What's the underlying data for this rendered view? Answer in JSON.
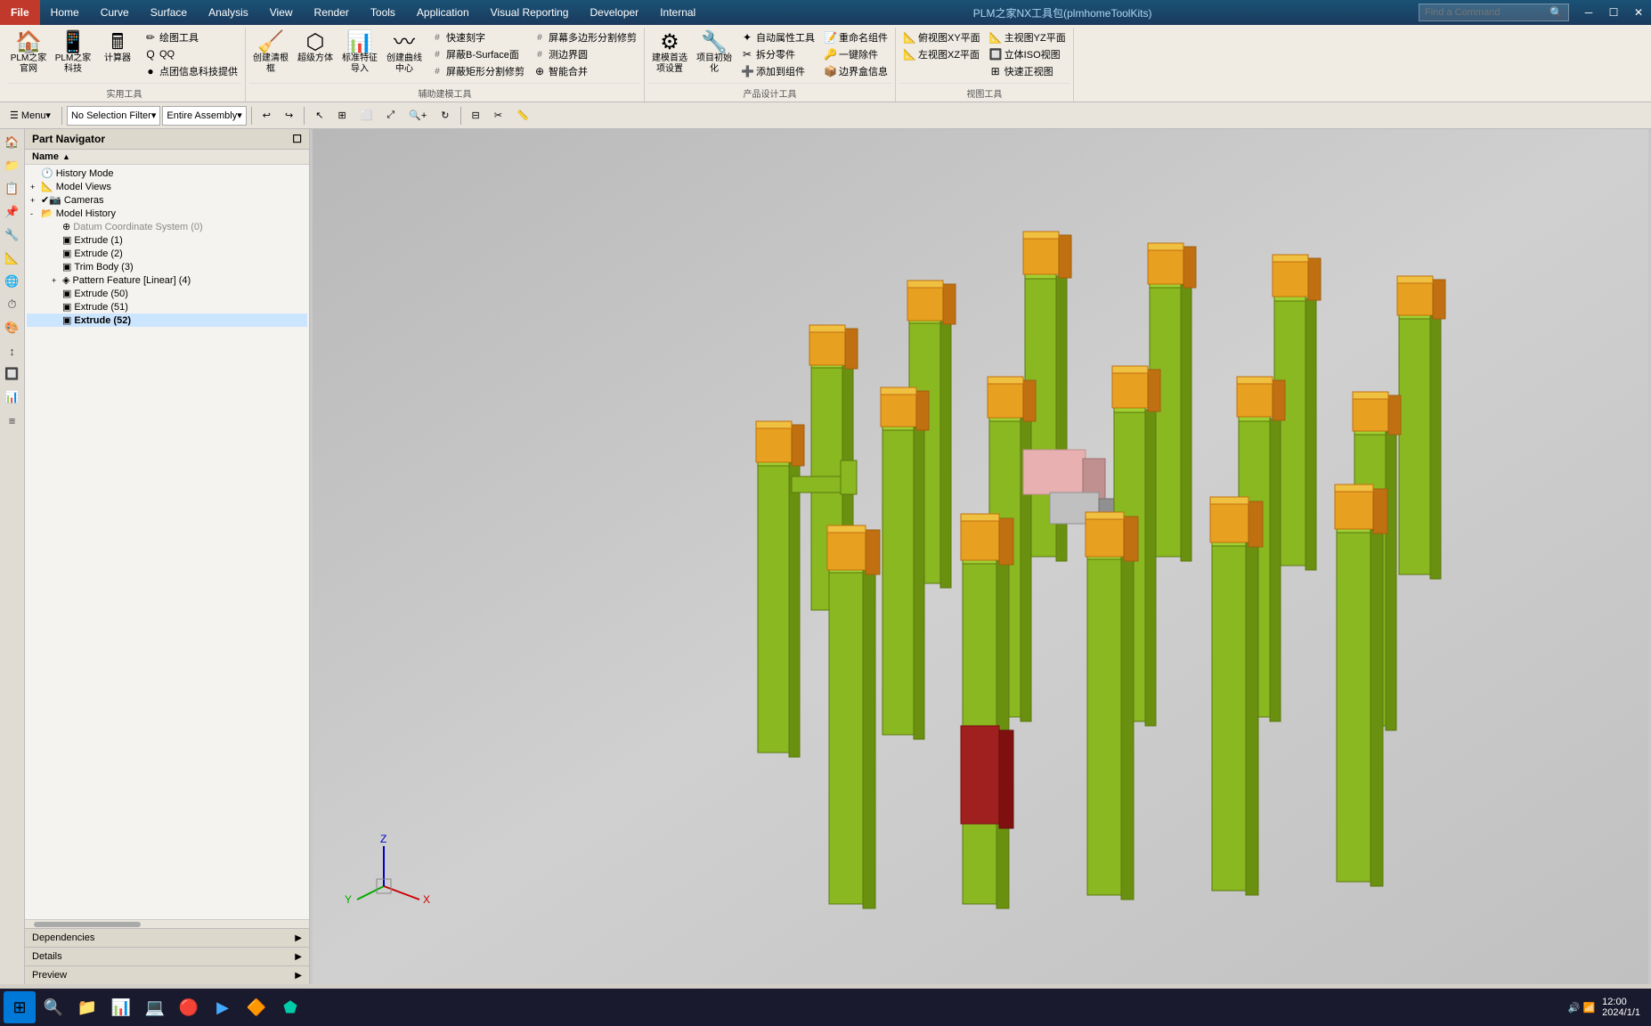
{
  "titlebar": {
    "file_label": "File",
    "menu_items": [
      "Home",
      "Curve",
      "Surface",
      "Analysis",
      "View",
      "Render",
      "Tools",
      "Application",
      "Visual Reporting",
      "Developer",
      "Internal"
    ],
    "plm_title": "PLM之家NX工具包(plmhomeToolKits)",
    "find_placeholder": "Find a Command",
    "win_minimize": "─",
    "win_restore": "☐",
    "win_close": "✕"
  },
  "toolbar_left": {
    "menu_label": "☰ Menu▾",
    "filter_label": "No Selection Filter",
    "assembly_label": "Entire Assembly"
  },
  "part_navigator": {
    "title": "Part Navigator",
    "name_header": "Name",
    "tree_items": [
      {
        "id": "history-mode",
        "label": "History Mode",
        "indent": 0,
        "icon": "🕐",
        "expand": "",
        "bold": false
      },
      {
        "id": "model-views",
        "label": "Model Views",
        "indent": 0,
        "icon": "📐",
        "expand": "+",
        "bold": false
      },
      {
        "id": "cameras",
        "label": "Cameras",
        "indent": 0,
        "icon": "📷",
        "expand": "+",
        "bold": false,
        "checked": true
      },
      {
        "id": "model-history",
        "label": "Model History",
        "indent": 0,
        "icon": "📁",
        "expand": "-",
        "bold": false
      },
      {
        "id": "datum-cs",
        "label": "Datum Coordinate System (0)",
        "indent": 2,
        "icon": "⊕",
        "expand": "",
        "bold": false,
        "gray": true
      },
      {
        "id": "extrude1",
        "label": "Extrude (1)",
        "indent": 2,
        "icon": "▣",
        "expand": "",
        "bold": false
      },
      {
        "id": "extrude2",
        "label": "Extrude (2)",
        "indent": 2,
        "icon": "▣",
        "expand": "",
        "bold": false
      },
      {
        "id": "trim-body",
        "label": "Trim Body (3)",
        "indent": 2,
        "icon": "▣",
        "expand": "",
        "bold": false
      },
      {
        "id": "pattern-feature",
        "label": "Pattern Feature [Linear] (4)",
        "indent": 2,
        "icon": "◈",
        "expand": "+",
        "bold": false
      },
      {
        "id": "extrude50",
        "label": "Extrude (50)",
        "indent": 2,
        "icon": "▣",
        "expand": "",
        "bold": false
      },
      {
        "id": "extrude51",
        "label": "Extrude (51)",
        "indent": 2,
        "icon": "▣",
        "expand": "",
        "bold": false
      },
      {
        "id": "extrude52",
        "label": "Extrude (52)",
        "indent": 2,
        "icon": "▣",
        "expand": "",
        "bold": true
      }
    ],
    "bottom_panels": [
      {
        "id": "dependencies",
        "label": "Dependencies",
        "expanded": false
      },
      {
        "id": "details",
        "label": "Details",
        "expanded": false
      },
      {
        "id": "preview",
        "label": "Preview",
        "expanded": false
      }
    ]
  },
  "ribbon": {
    "tabs": [
      "File",
      "Home",
      "Curve",
      "Surface",
      "Analysis",
      "View",
      "Render",
      "Tools",
      "Application",
      "Visual Reporting",
      "Developer",
      "Internal"
    ],
    "active_tab": "Home",
    "groups": [
      {
        "id": "plm-tools",
        "label": "实用工具",
        "items": [
          {
            "type": "big",
            "icon": "🏠",
            "label": "PLM之家官网"
          },
          {
            "type": "big",
            "icon": "📱",
            "label": "PLM之家科技"
          },
          {
            "type": "big",
            "icon": "🖥",
            "label": "计算器"
          },
          {
            "type": "col",
            "items": [
              {
                "icon": "✏",
                "label": "绘图工具"
              },
              {
                "icon": "Q",
                "label": "QQ"
              },
              {
                "icon": "●",
                "label": "点团信息科技提供"
              }
            ]
          }
        ]
      },
      {
        "id": "build-tools",
        "label": "辅助建模工具",
        "items": [
          {
            "type": "big",
            "icon": "🧹",
            "label": "创建清根框"
          },
          {
            "type": "big",
            "icon": "⬡",
            "label": "超级方体"
          },
          {
            "type": "big",
            "icon": "📊",
            "label": "标准特征导入"
          },
          {
            "type": "big",
            "icon": "〰",
            "label": "创建曲线中心"
          },
          {
            "type": "col",
            "items": [
              {
                "icon": "#",
                "label": "#快速刻字"
              },
              {
                "icon": "#",
                "label": "#屏蔽B-Surface面"
              },
              {
                "icon": "#",
                "label": "#屏蔽矩形分割修剪"
              }
            ]
          },
          {
            "type": "col",
            "items": [
              {
                "icon": "#",
                "label": "#屏幕多边形分割修剪"
              },
              {
                "icon": "#",
                "label": "#测边界圆"
              },
              {
                "icon": "⊕",
                "label": "智能合并"
              }
            ]
          }
        ]
      },
      {
        "id": "product-design",
        "label": "产品设计工具",
        "items": [
          {
            "type": "big",
            "icon": "⚙",
            "label": "建模首选项设置"
          },
          {
            "type": "big",
            "icon": "🔧",
            "label": "项目初始化"
          },
          {
            "type": "col",
            "items": [
              {
                "icon": "✦",
                "label": "自动属性工具"
              },
              {
                "icon": "✂",
                "label": "拆分零件"
              },
              {
                "icon": "➕",
                "label": "添加到组件"
              }
            ]
          },
          {
            "type": "col",
            "items": [
              {
                "icon": "📝",
                "label": "重命名组件"
              },
              {
                "icon": "🔑",
                "label": "一键除件"
              },
              {
                "icon": "📦",
                "label": "边界盒信息"
              }
            ]
          }
        ]
      },
      {
        "id": "view-tools",
        "label": "视图工具",
        "items": [
          {
            "type": "col",
            "items": [
              {
                "icon": "📐",
                "label": "俯视图XY平面"
              },
              {
                "icon": "📐",
                "label": "左视图XZ平面"
              }
            ]
          },
          {
            "type": "col",
            "items": [
              {
                "icon": "📐",
                "label": "主视图YZ平面"
              },
              {
                "icon": "📐",
                "label": "立体ISO视图"
              },
              {
                "icon": "📐",
                "label": "快速正视图"
              }
            ]
          }
        ]
      }
    ]
  },
  "viewport": {
    "background_color": "#c8c8c8"
  },
  "taskbar": {
    "items": [
      "⊞",
      "📁",
      "💬",
      "📊",
      "💻",
      "🔴",
      "▶",
      "📎",
      "🔵"
    ]
  }
}
